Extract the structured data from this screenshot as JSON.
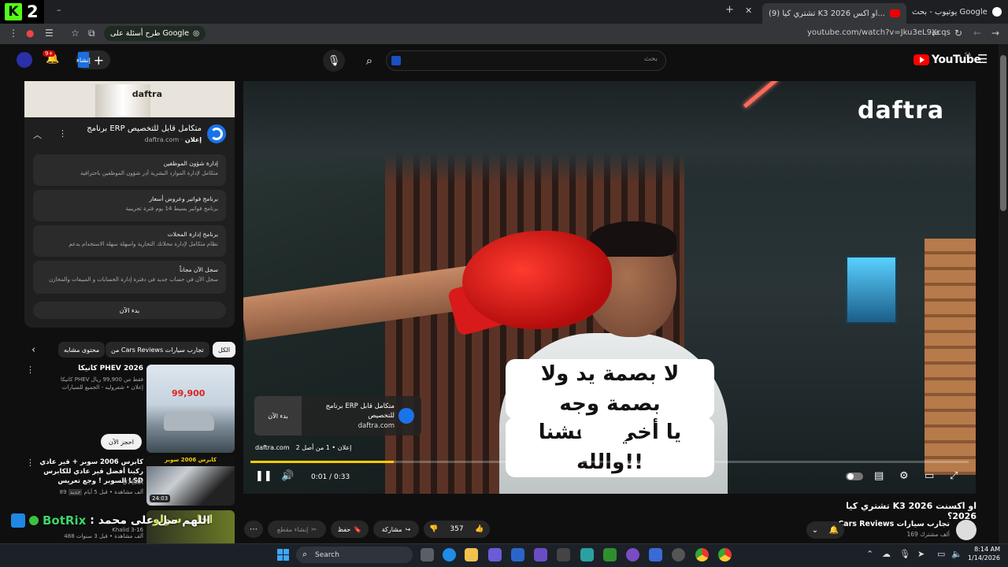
{
  "browser": {
    "kick_number": "2",
    "tabs": [
      {
        "label": "يوتيوب - بحث Google"
      },
      {
        "label": "(9) تشتري كيا K3 2026 او اكس..."
      }
    ],
    "new_tab": "+",
    "url": "youtube.com/watch?v=Jku3eL9Xcqs",
    "google_pill": "طرح أسئلة على Google"
  },
  "yt_header": {
    "search_placeholder": "بحث",
    "logo_text": "YouTube",
    "country_code": "SA",
    "notification_count": "9+",
    "create_label": "إنشاء"
  },
  "ad": {
    "title": "برنامج ERP متكامل قابل للتخصيص",
    "sponsor": "إعلان",
    "domain": "daftra.com",
    "banner_logo": "daftra",
    "links": [
      {
        "title": "إدارة شؤون الموظفين",
        "desc": "متكامل لإدارة الموارد البشرية أدِر شؤون الموظفين باحترافية"
      },
      {
        "title": "برنامج فواتير وعروض أسعار",
        "desc": "برنامج فواتير بسيط 14 يوم فترة تجريبية"
      },
      {
        "title": "برنامج إدارة المحلات",
        "desc": "نظام متكامل لإدارة محلاتك التجارية واسهلة سهلة الاستخدام بدعم"
      },
      {
        "title": "سجل الآن مجاناً",
        "desc": "سجل الآن في حساب جديد في دفترة إدارة الحسابات و المبيعات والمخازن"
      }
    ],
    "start_button": "بدء الآن"
  },
  "chips": {
    "all": "الكل",
    "from_channel": "من Cars Reviews تجارب سيارات",
    "related": "محتوى مشابه"
  },
  "recommendations": [
    {
      "title": "كانيكا PHEV 2026",
      "desc_lines": [
        "كانيكا PHEV فقط من 99,900 ريال",
        "إعلان • شفروليه - الجميع للسيارات"
      ],
      "thumb_price": "99,900",
      "book_button": "احجز الآن"
    },
    {
      "title": "كابرس 2006 سوبر + قير عادي ركبنا أفضل قير عادي للكابرس السوبر ! وجع تعريس LSD",
      "channel": "D7CAR",
      "meta": "89 ألف مشاهدة • قبل 5 أيام",
      "badge": "جديد",
      "duration": "24:03"
    },
    {
      "title": "احلى سولو",
      "channel": "Khalid 3-16",
      "meta": "488 ألف مشاهدة • قبل 3 سنوات"
    }
  ],
  "overlay": {
    "botrix_name": "BotRix",
    "botrix_message": ": اللهم صل على محمد"
  },
  "player": {
    "brand_watermark": "daftra",
    "caption_lines": [
      "لا بصمة يد ولا بصمة وجه",
      "يا أخي طفشنا والله!!"
    ],
    "caption_emojis": "😡😭",
    "ad_overlay_title": "برنامج ERP متكامل قابل للتخصيص",
    "ad_overlay_url": "daftra.com",
    "ad_overlay_start": "بدء الآن",
    "ad_info_domain": "daftra.com",
    "ad_info_label": "إعلان • 1 من أصل 2",
    "time": "0:01 / 0:33",
    "progress_fraction": 0.2,
    "accent": "#ffcc00"
  },
  "video": {
    "title": "تشتري كيا K3 2026 او اكسنت 2026؟",
    "channel_name": "Cars Reviews تجارب سيارات",
    "channel_subs": "169 ألف مشترك",
    "likes": "357",
    "share": "مشاركة",
    "save": "حفظ",
    "clip": "إنشاء مقطع"
  },
  "taskbar": {
    "search": "Search",
    "time": "8:14 AM",
    "date": "1/14/2026"
  }
}
